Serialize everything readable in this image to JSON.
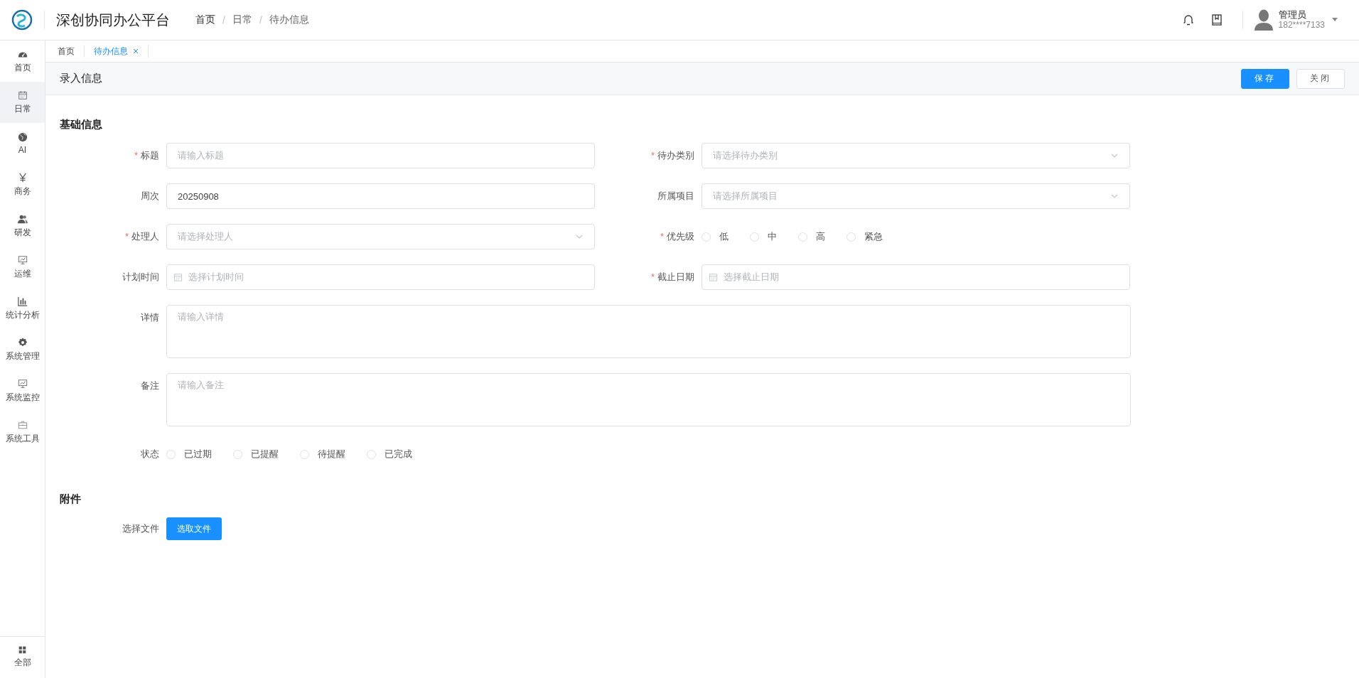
{
  "app": {
    "title": "深创协同办公平台"
  },
  "breadcrumb": {
    "items": [
      "首页",
      "日常",
      "待办信息"
    ],
    "separator": "/"
  },
  "user": {
    "name": "管理员",
    "phone": "182****7133"
  },
  "sidebar": {
    "items": [
      {
        "label": "首页",
        "selected": false
      },
      {
        "label": "日常",
        "selected": true
      },
      {
        "label": "AI",
        "selected": false
      },
      {
        "label": "商务",
        "selected": false
      },
      {
        "label": "研发",
        "selected": false
      },
      {
        "label": "运维",
        "selected": false
      },
      {
        "label": "统计分析",
        "selected": false
      },
      {
        "label": "系统管理",
        "selected": false
      },
      {
        "label": "系统监控",
        "selected": false
      },
      {
        "label": "系统工具",
        "selected": false
      }
    ],
    "bottom": {
      "label": "全部"
    }
  },
  "tabs": [
    {
      "label": "首页",
      "selected": false,
      "closable": false
    },
    {
      "label": "待办信息",
      "selected": true,
      "closable": true
    }
  ],
  "page": {
    "title": "录入信息",
    "buttons": [
      {
        "label": "保存",
        "kind": "primary"
      },
      {
        "label": "关闭",
        "kind": "default"
      }
    ]
  },
  "basic": {
    "title": "基础信息",
    "required_mark": "*",
    "rows": [
      [
        {
          "label": "标题",
          "required": true,
          "kind": "text",
          "placeholder": "请输入标题"
        },
        {
          "label": "待办类别",
          "required": true,
          "kind": "select",
          "placeholder": "请选择待办类别"
        }
      ],
      [
        {
          "label": "周次",
          "required": false,
          "kind": "text",
          "value": "20250908"
        },
        {
          "label": "所属项目",
          "required": false,
          "kind": "select",
          "placeholder": "请选择所属项目"
        }
      ],
      [
        {
          "label": "处理人",
          "required": true,
          "kind": "select",
          "placeholder": "请选择处理人"
        },
        {
          "label": "优先级",
          "required": true,
          "kind": "radio",
          "options": [
            {
              "label": "低",
              "selected": false
            },
            {
              "label": "中",
              "selected": false
            },
            {
              "label": "高",
              "selected": false
            },
            {
              "label": "紧急",
              "selected": false
            }
          ]
        }
      ],
      [
        {
          "label": "计划时间",
          "required": false,
          "kind": "date",
          "placeholder": "选择计划时间"
        },
        {
          "label": "截止日期",
          "required": true,
          "kind": "date",
          "placeholder": "选择截止日期"
        }
      ],
      [
        {
          "label": "详情",
          "required": false,
          "kind": "textarea",
          "placeholder": "请输入详情"
        }
      ],
      [
        {
          "label": "备注",
          "required": false,
          "kind": "textarea",
          "placeholder": "请输入备注"
        }
      ],
      [
        {
          "label": "状态",
          "required": false,
          "kind": "radio",
          "options": [
            {
              "label": "已过期",
              "selected": false
            },
            {
              "label": "已提醒",
              "selected": false
            },
            {
              "label": "待提醒",
              "selected": false
            },
            {
              "label": "已完成",
              "selected": false
            }
          ]
        }
      ]
    ]
  },
  "attachment": {
    "title": "附件",
    "label": "选择文件",
    "button": "选取文件"
  }
}
